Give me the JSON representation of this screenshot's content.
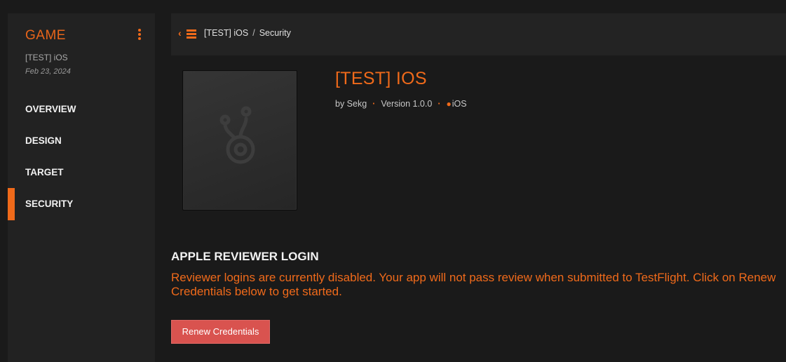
{
  "sidebar": {
    "title": "GAME",
    "subtitle": "[TEST] iOS",
    "date": "Feb 23, 2024",
    "items": [
      {
        "label": "OVERVIEW"
      },
      {
        "label": "DESIGN"
      },
      {
        "label": "TARGET"
      },
      {
        "label": "SECURITY",
        "active": true
      }
    ]
  },
  "topbar": {
    "back_icon": "chevron-left-icon",
    "menu_icon": "hamburger-icon",
    "breadcrumb": [
      "[TEST] iOS",
      "Security"
    ],
    "separator": "/"
  },
  "app": {
    "title": "[TEST] IOS",
    "author": "by Sekg",
    "version": "Version 1.0.0",
    "platform": "iOS",
    "platform_icon": "apple-icon",
    "icon_placeholder": "app-placeholder-icon"
  },
  "security": {
    "heading": "APPLE REVIEWER LOGIN",
    "message": "Reviewer logins are currently disabled. Your app will not pass review when submitted to TestFlight. Click on Renew Credentials below to get started.",
    "button_label": "Renew Credentials"
  },
  "colors": {
    "accent": "#f06a1a",
    "button": "#d9534f",
    "background": "#1a1a1a",
    "panel": "#222222"
  }
}
